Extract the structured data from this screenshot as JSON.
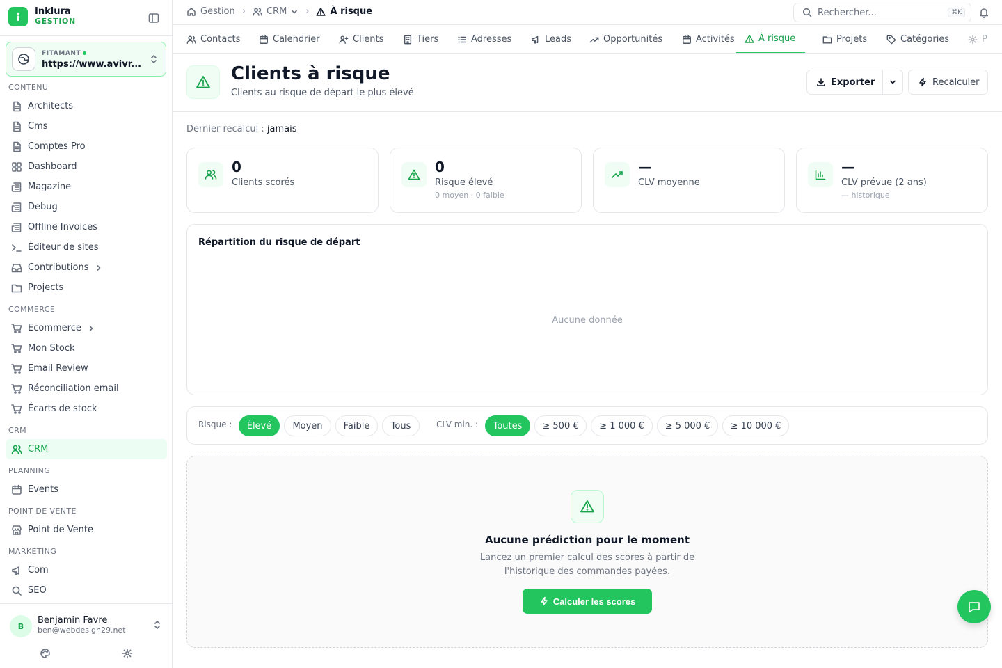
{
  "brand": {
    "name": "Inklura",
    "sub": "GESTION"
  },
  "site": {
    "label": "FITAMANT",
    "url": "https://www.avivr..."
  },
  "sidebar": {
    "sections": [
      {
        "title": "CONTENU",
        "items": [
          {
            "label": "Architects",
            "icon": "document-icon"
          },
          {
            "label": "Cms",
            "icon": "document-icon"
          },
          {
            "label": "Comptes Pro",
            "icon": "document-icon"
          },
          {
            "label": "Dashboard",
            "icon": "grid-icon"
          },
          {
            "label": "Magazine",
            "icon": "newspaper-icon"
          },
          {
            "label": "Debug",
            "icon": "newspaper-icon"
          },
          {
            "label": "Offline Invoices",
            "icon": "newspaper-icon"
          },
          {
            "label": "Éditeur de sites",
            "icon": "terminal-icon"
          },
          {
            "label": "Contributions",
            "icon": "inbox-icon",
            "expandable": true
          },
          {
            "label": "Projects",
            "icon": "folder-icon"
          }
        ]
      },
      {
        "title": "COMMERCE",
        "items": [
          {
            "label": "Ecommerce",
            "icon": "cart-icon",
            "expandable": true
          },
          {
            "label": "Mon Stock",
            "icon": "cart-icon"
          },
          {
            "label": "Email Review",
            "icon": "cart-icon"
          },
          {
            "label": "Réconciliation email",
            "icon": "cart-icon"
          },
          {
            "label": "Écarts de stock",
            "icon": "cart-icon"
          }
        ]
      },
      {
        "title": "CRM",
        "items": [
          {
            "label": "CRM",
            "icon": "users-icon",
            "active": true
          }
        ]
      },
      {
        "title": "PLANNING",
        "items": [
          {
            "label": "Events",
            "icon": "calendar-icon"
          }
        ]
      },
      {
        "title": "POINT DE VENTE",
        "items": [
          {
            "label": "Point de Vente",
            "icon": "store-icon"
          }
        ]
      },
      {
        "title": "MARKETING",
        "items": [
          {
            "label": "Com",
            "icon": "megaphone-icon"
          },
          {
            "label": "SEO",
            "icon": "search-icon"
          }
        ]
      }
    ]
  },
  "user": {
    "initial": "B",
    "name": "Benjamin Favre",
    "email": "ben@webdesign29.net"
  },
  "breadcrumb": {
    "items": [
      "Gestion",
      "CRM",
      "À risque"
    ]
  },
  "search": {
    "placeholder": "Rechercher...",
    "shortcut": "⌘K"
  },
  "tabs": [
    {
      "label": "Contacts",
      "icon": "users-icon"
    },
    {
      "label": "Calendrier",
      "icon": "calendar-icon"
    },
    {
      "label": "Clients",
      "icon": "user-plus-icon"
    },
    {
      "label": "Tiers",
      "icon": "building-icon"
    },
    {
      "label": "Adresses",
      "icon": "list-icon"
    },
    {
      "label": "Leads",
      "icon": "megaphone-icon"
    },
    {
      "label": "Opportunités",
      "icon": "trending-icon"
    },
    {
      "label": "Activités",
      "icon": "calendar-icon"
    },
    {
      "label": "À risque",
      "icon": "alert-icon",
      "active": true
    },
    {
      "label": "Projets",
      "icon": "folder-icon"
    },
    {
      "label": "Catégories",
      "icon": "tag-icon"
    },
    {
      "label": "P",
      "icon": "gear-icon"
    }
  ],
  "header": {
    "title": "Clients à risque",
    "subtitle": "Clients au risque de départ le plus élevé",
    "export_label": "Exporter",
    "recalc_label": "Recalculer"
  },
  "last_recalc": {
    "label": "Dernier recalcul :",
    "value": "jamais"
  },
  "stats": [
    {
      "value": "0",
      "label": "Clients scorés",
      "note": "",
      "icon": "users-icon"
    },
    {
      "value": "0",
      "label": "Risque élevé",
      "note": "0 moyen · 0 faible",
      "icon": "alert-icon"
    },
    {
      "value": "—",
      "label": "CLV moyenne",
      "note": "",
      "icon": "trending-icon"
    },
    {
      "value": "—",
      "label": "CLV prévue (2 ans)",
      "note": "— historique",
      "icon": "bar-chart-icon"
    }
  ],
  "distribution": {
    "title": "Répartition du risque de départ",
    "empty": "Aucune donnée"
  },
  "filters": {
    "risk_label": "Risque :",
    "risk_options": [
      "Élevé",
      "Moyen",
      "Faible",
      "Tous"
    ],
    "risk_selected": "Élevé",
    "clv_label": "CLV min. :",
    "clv_options": [
      "Toutes",
      "≥ 500 €",
      "≥ 1 000 €",
      "≥ 5 000 €",
      "≥ 10 000 €"
    ],
    "clv_selected": "Toutes"
  },
  "empty_state": {
    "title": "Aucune prédiction pour le moment",
    "line1": "Lancez un premier calcul des scores à partir de",
    "line2": "l'historique des commandes payées.",
    "button": "Calculer les scores"
  },
  "colors": {
    "accent": "#22c55e",
    "accent_dark": "#16a34a",
    "accent_bg": "#f0fdf4"
  }
}
